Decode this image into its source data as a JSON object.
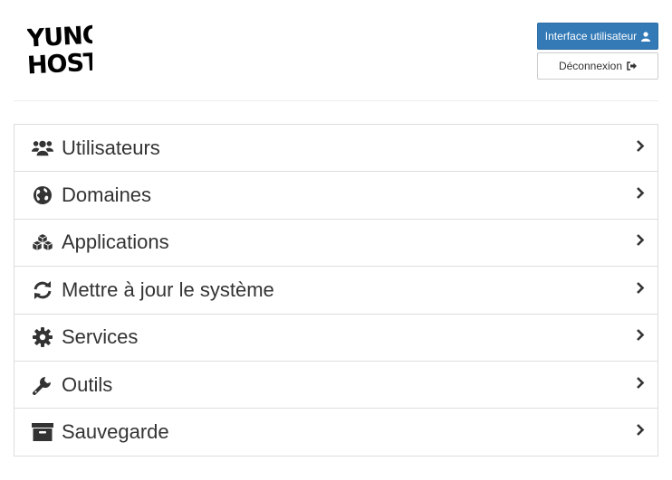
{
  "logo": {
    "line1": "YUNO",
    "line2": "HOST"
  },
  "header": {
    "user_interface_label": "Interface utilisateur",
    "logout_label": "Déconnexion"
  },
  "menu": {
    "items": [
      {
        "label": "Utilisateurs",
        "icon": "users-icon"
      },
      {
        "label": "Domaines",
        "icon": "globe-icon"
      },
      {
        "label": "Applications",
        "icon": "cubes-icon"
      },
      {
        "label": "Mettre à jour le système",
        "icon": "refresh-icon"
      },
      {
        "label": "Services",
        "icon": "gear-icon"
      },
      {
        "label": "Outils",
        "icon": "wrench-icon"
      },
      {
        "label": "Sauvegarde",
        "icon": "archive-icon"
      }
    ]
  },
  "colors": {
    "primary": "#337ab7",
    "border": "#dddddd",
    "text": "#333333"
  }
}
